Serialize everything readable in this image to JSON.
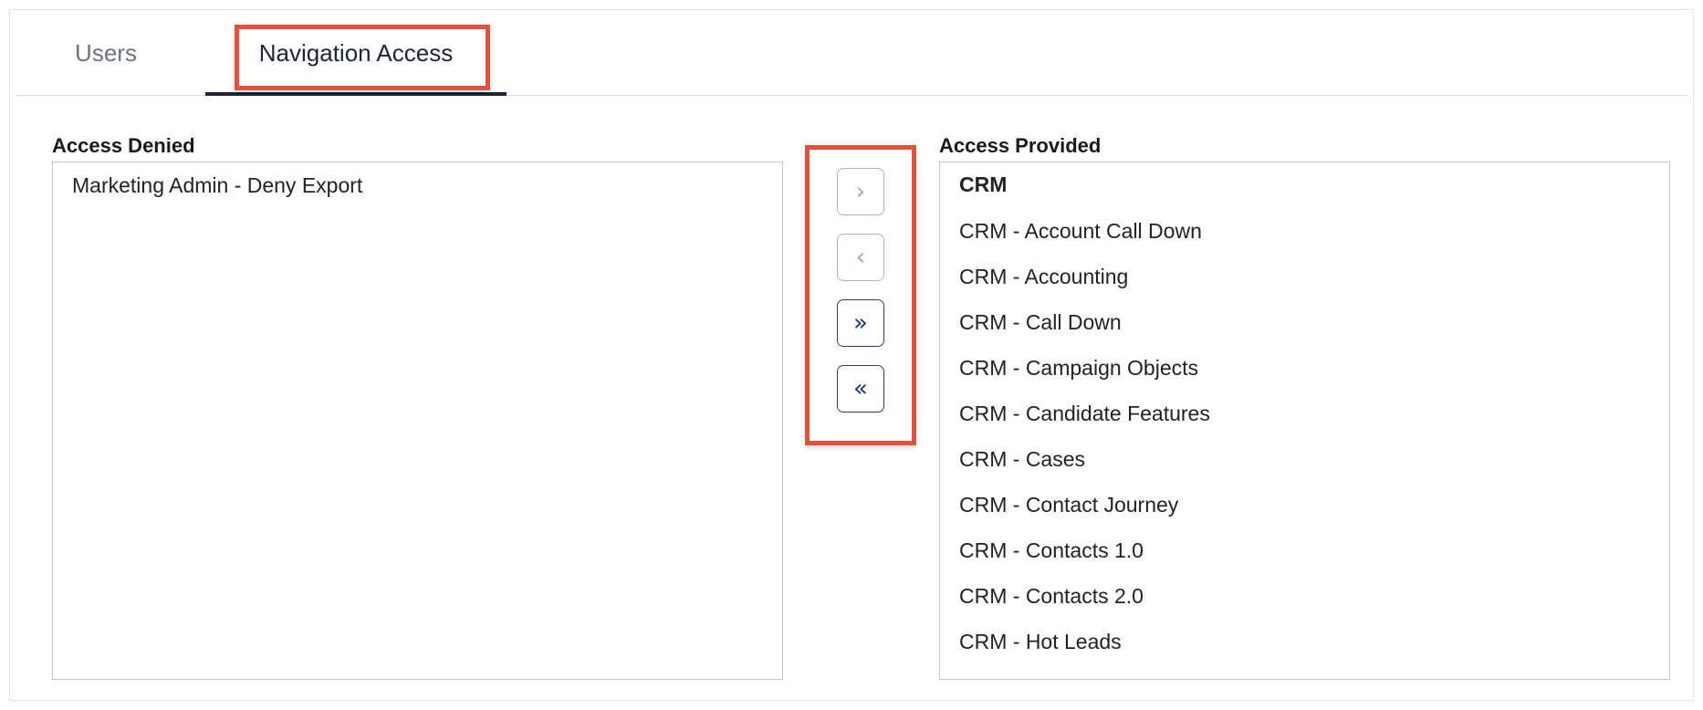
{
  "tabs": [
    {
      "label": "Users",
      "active": false
    },
    {
      "label": "Navigation Access",
      "active": true
    }
  ],
  "access_denied": {
    "label": "Access Denied",
    "items": [
      "Marketing Admin - Deny Export"
    ]
  },
  "access_provided": {
    "label": "Access Provided",
    "group": "CRM",
    "items": [
      "CRM - Account Call Down",
      "CRM - Accounting",
      "CRM - Call Down",
      "CRM - Campaign Objects",
      "CRM - Candidate Features",
      "CRM - Cases",
      "CRM - Contact Journey",
      "CRM - Contacts 1.0",
      "CRM - Contacts 2.0",
      "CRM - Hot Leads"
    ]
  },
  "transfer_buttons": {
    "move_right": {
      "glyph": "›",
      "icon": "chevron-right-icon",
      "enabled": false
    },
    "move_left": {
      "glyph": "‹",
      "icon": "chevron-left-icon",
      "enabled": false
    },
    "move_all_right": {
      "glyph": "»",
      "icon": "double-chevron-right-icon",
      "enabled": true
    },
    "move_all_left": {
      "glyph": "«",
      "icon": "double-chevron-left-icon",
      "enabled": true
    }
  },
  "colors": {
    "highlight": "#e0513f",
    "active_tab": "#1b2536",
    "enabled_button": "#1f3275",
    "disabled_button": "#9aa9bf"
  }
}
